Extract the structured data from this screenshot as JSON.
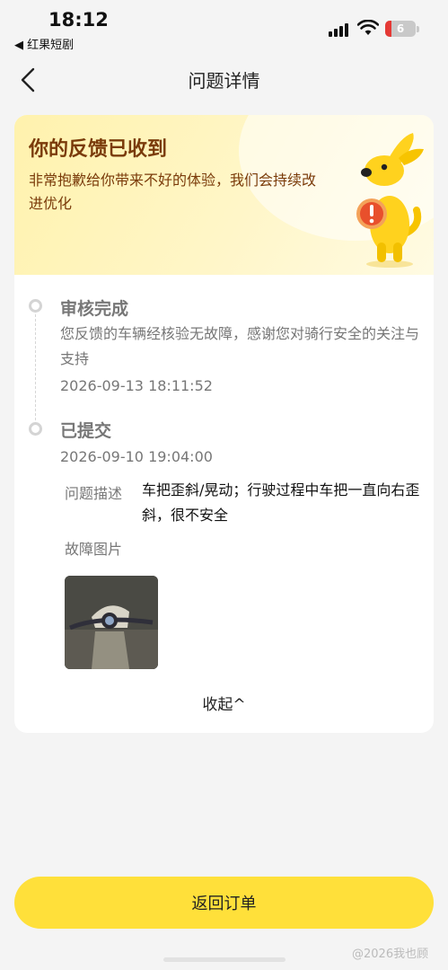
{
  "status_bar": {
    "time": "18:12",
    "back_app": "◀ 红果短剧",
    "battery": "6"
  },
  "nav": {
    "title": "问题详情"
  },
  "banner": {
    "title": "你的反馈已收到",
    "subtitle": "非常抱歉给你带来不好的体验，我们会持续改进优化"
  },
  "timeline": [
    {
      "title": "审核完成",
      "description": "您反馈的车辆经核验无故障，感谢您对骑行安全的关注与支持",
      "time": "2026-09-13 18:11:52"
    },
    {
      "title": "已提交",
      "time": "2026-09-10 19:04:00"
    }
  ],
  "details": {
    "desc_label": "问题描述",
    "desc_value": "车把歪斜/晃动；行驶过程中车把一直向右歪斜，很不安全",
    "image_label": "故障图片"
  },
  "collapse_label": "收起^",
  "return_button": "返回订单",
  "watermark": "@2026我也顾",
  "colors": {
    "accent": "#ffe03a",
    "banner_text": "#7a3b0a",
    "battery_low": "#e53935"
  }
}
